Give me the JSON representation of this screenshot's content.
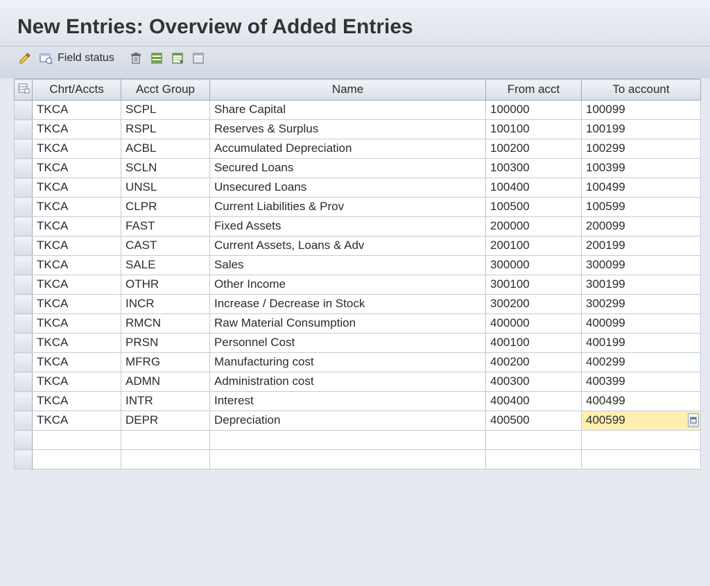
{
  "title": "New Entries: Overview of Added Entries",
  "toolbar": {
    "field_status_label": "Field status"
  },
  "columns": {
    "chrt_accts": "Chrt/Accts",
    "acct_group": "Acct Group",
    "name": "Name",
    "from_acct": "From acct",
    "to_account": "To account"
  },
  "rows": [
    {
      "ca": "TKCA",
      "ag": "SCPL",
      "name": "Share Capital",
      "from": "100000",
      "to": "100099"
    },
    {
      "ca": "TKCA",
      "ag": "RSPL",
      "name": "Reserves & Surplus",
      "from": "100100",
      "to": "100199"
    },
    {
      "ca": "TKCA",
      "ag": "ACBL",
      "name": "Accumulated Depreciation",
      "from": "100200",
      "to": "100299"
    },
    {
      "ca": "TKCA",
      "ag": "SCLN",
      "name": "Secured Loans",
      "from": "100300",
      "to": "100399"
    },
    {
      "ca": "TKCA",
      "ag": "UNSL",
      "name": "Unsecured Loans",
      "from": "100400",
      "to": "100499"
    },
    {
      "ca": "TKCA",
      "ag": "CLPR",
      "name": "Current Liabilities & Prov",
      "from": "100500",
      "to": "100599"
    },
    {
      "ca": "TKCA",
      "ag": "FAST",
      "name": "Fixed Assets",
      "from": "200000",
      "to": "200099"
    },
    {
      "ca": "TKCA",
      "ag": "CAST",
      "name": "Current Assets, Loans & Adv",
      "from": "200100",
      "to": "200199"
    },
    {
      "ca": "TKCA",
      "ag": "SALE",
      "name": "Sales",
      "from": "300000",
      "to": "300099"
    },
    {
      "ca": "TKCA",
      "ag": "OTHR",
      "name": "Other Income",
      "from": "300100",
      "to": "300199"
    },
    {
      "ca": "TKCA",
      "ag": "INCR",
      "name": "Increase / Decrease in Stock",
      "from": "300200",
      "to": "300299"
    },
    {
      "ca": "TKCA",
      "ag": "RMCN",
      "name": "Raw Material Consumption",
      "from": "400000",
      "to": "400099"
    },
    {
      "ca": "TKCA",
      "ag": "PRSN",
      "name": "Personnel Cost",
      "from": "400100",
      "to": "400199"
    },
    {
      "ca": "TKCA",
      "ag": "MFRG",
      "name": "Manufacturing cost",
      "from": "400200",
      "to": "400299"
    },
    {
      "ca": "TKCA",
      "ag": "ADMN",
      "name": "Administration cost",
      "from": "400300",
      "to": "400399"
    },
    {
      "ca": "TKCA",
      "ag": "INTR",
      "name": "Interest",
      "from": "400400",
      "to": "400499"
    },
    {
      "ca": "TKCA",
      "ag": "DEPR",
      "name": "Depreciation",
      "from": "400500",
      "to": "400599",
      "active": true
    }
  ],
  "empty_rows": 2
}
